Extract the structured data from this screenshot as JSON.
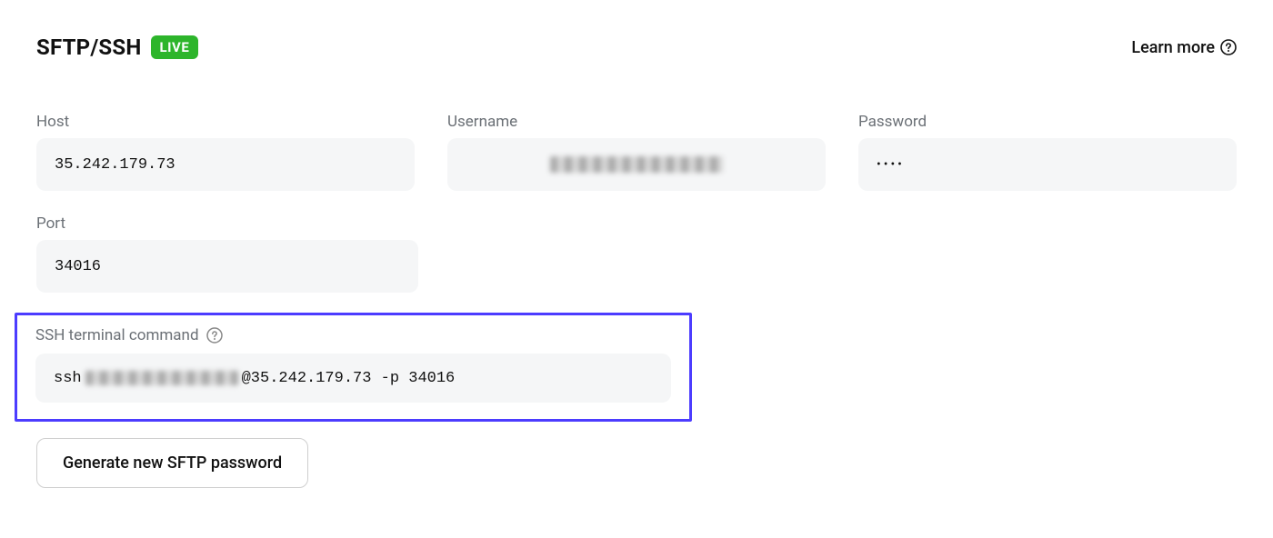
{
  "header": {
    "title": "SFTP/SSH",
    "badge": "LIVE",
    "learn_more": "Learn more"
  },
  "fields": {
    "host": {
      "label": "Host",
      "value": "35.242.179.73"
    },
    "username": {
      "label": "Username"
    },
    "password": {
      "label": "Password",
      "value_mask": "••••"
    },
    "port": {
      "label": "Port",
      "value": "34016"
    }
  },
  "ssh": {
    "label": "SSH terminal command",
    "prefix": "ssh ",
    "suffix": "@35.242.179.73 -p 34016"
  },
  "actions": {
    "generate": "Generate new SFTP password"
  }
}
